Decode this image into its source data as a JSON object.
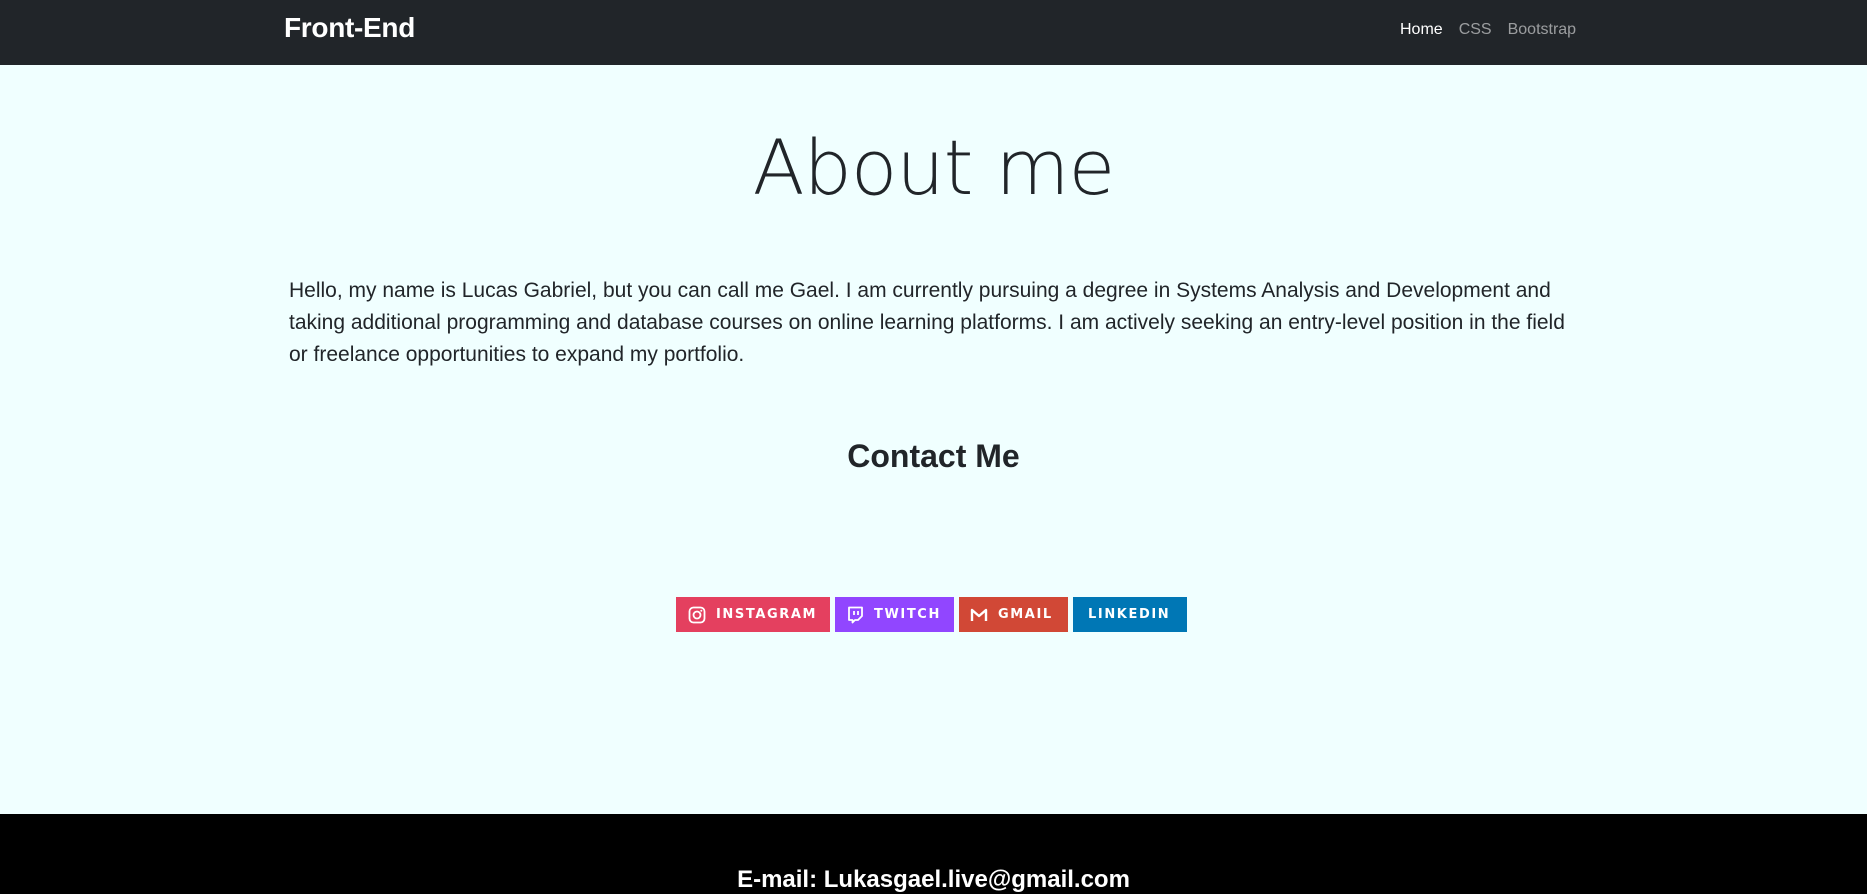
{
  "navbar": {
    "brand": "Front-End",
    "links": [
      {
        "label": "Home",
        "active": true
      },
      {
        "label": "CSS",
        "active": false
      },
      {
        "label": "Bootstrap",
        "active": false
      }
    ],
    "background": "#212529"
  },
  "main": {
    "title": "About me",
    "bio": "Hello, my name is Lucas Gabriel, but you can call me Gael. I am currently pursuing a degree in Systems Analysis and Development and taking additional programming and database courses on online learning platforms. I am actively seeking an entry-level position in the field or freelance opportunities to expand my portfolio.",
    "contact_heading": "Contact Me",
    "background": "#f0ffff"
  },
  "contact_badges": [
    {
      "label": "INSTAGRAM",
      "icon": "instagram-icon",
      "color": "#e4405f"
    },
    {
      "label": "TWITCH",
      "icon": "twitch-icon",
      "color": "#9146ff"
    },
    {
      "label": "GMAIL",
      "icon": "gmail-icon",
      "color": "#d14836"
    },
    {
      "label": "LINKEDIN",
      "icon": null,
      "color": "#0077b5"
    }
  ],
  "footer": {
    "email": "E-mail: Lukasgael.live@gmail.com",
    "background": "#000000"
  }
}
